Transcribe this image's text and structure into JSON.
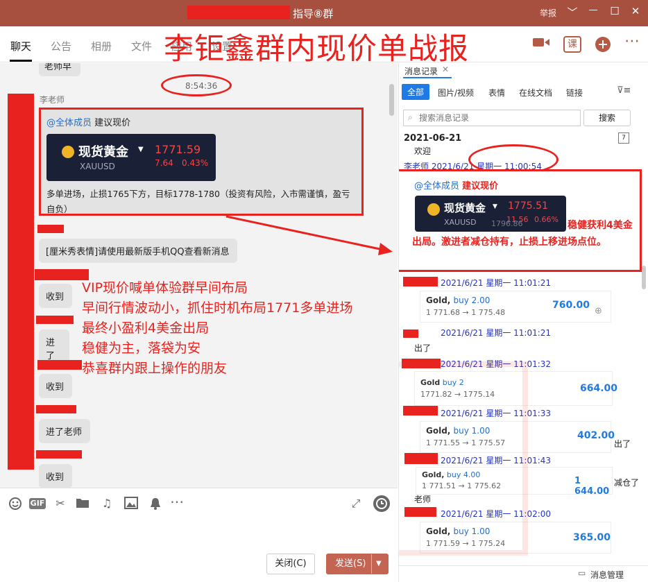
{
  "window": {
    "title": "指导⑧群",
    "report_label": "举报",
    "min_glyph": "—",
    "max_glyph": "☐",
    "close_glyph": "✕",
    "chevron_glyph": "﹀"
  },
  "tabs": [
    "聊天",
    "公告",
    "相册",
    "文件",
    "应用",
    "设置"
  ],
  "overlay_title": "李钜鑫群内现价单战报",
  "header_icons": {
    "video": "video-camera-icon",
    "course_label": "课",
    "add": "plus-circle-icon",
    "more": "⋯"
  },
  "chat": {
    "top_bubble": "老师早",
    "time": "8:54:36",
    "sender": "李老师",
    "post": {
      "at_all": "@全体成员",
      "headline": "建议现价",
      "card": {
        "name": "现货黄金",
        "symbol": "XAUUSD",
        "price": "1771.59",
        "change": "7.64",
        "change_pct": "0.43%"
      },
      "body": "多单进场，止损1765下方，目标1778-1780（投资有风险，入市需谨慎，盈亏自负）"
    },
    "sticker_msg": "[厘米秀表情]请使用最新版手机QQ查看新消息",
    "replies": [
      "收到",
      "进了",
      "收到",
      "进了老师",
      "收到"
    ],
    "announcement": [
      "VIP现价喊单体验群早间布局",
      "早间行情波动小，抓住时机布局1771多单进场",
      "最终小盈利4美金出局",
      "稳健为主，落袋为安",
      "恭喜群内跟上操作的朋友"
    ]
  },
  "toolbar": {
    "icons": [
      "emoji-icon",
      "gif-icon",
      "scissors-icon",
      "folder-icon",
      "music-icon",
      "image-icon",
      "bell-icon",
      "more-icon"
    ],
    "gif_label": "GIF",
    "close_btn": "关闭(C)",
    "send_btn": "发送(S)"
  },
  "history": {
    "panel_title": "消息记录",
    "filters": [
      "全部",
      "图片/视频",
      "表情",
      "在线文档",
      "链接"
    ],
    "search_placeholder": "搜索消息记录",
    "search_btn": "搜索",
    "date": "2021-06-21",
    "welcome": "欢迎",
    "first_ts": "李老师 2021/6/21 星期一 11:00:54",
    "highlight": {
      "at_all": "@全体成员",
      "headline": "建议现价",
      "card": {
        "name": "现货黄金",
        "symbol": "XAUUSD",
        "price": "1775.51",
        "change": "11.56",
        "change_pct": "0.66%",
        "sub": "1796.86"
      },
      "note": "稳健获利4美金出局。激进者减仓持有，止损上移进场点位。"
    },
    "entries": [
      {
        "ts": "2021/6/21 星期一 11:01:21",
        "gold": "Gold,",
        "buy": "buy 2.00",
        "path": "1 771.68 → 1 775.48",
        "profit": "760.00",
        "tail": "出了"
      },
      {
        "ts": "2021/6/21 星期一 11:01:32",
        "gold": "Gold",
        "buy": "buy 2",
        "path": "1771.82 → 1775.14",
        "profit": "664.00",
        "tail": ""
      },
      {
        "ts": "2021/6/21 星期一 11:01:33",
        "gold": "Gold,",
        "buy": "buy 1.00",
        "path": "1 771.55 → 1 775.57",
        "profit": "402.00",
        "tail": "出了"
      },
      {
        "ts": "2021/6/21 星期一 11:01:43",
        "gold": "Gold,",
        "buy": "buy 4.00",
        "path": "1 771.51 → 1 775.62",
        "profit": "1 644.00",
        "tail": "减仓了"
      },
      {
        "ts": "2021/6/21 星期一 11:02:00",
        "gold": "Gold,",
        "buy": "buy 1.00",
        "path": "1 771.59 → 1 775.24",
        "profit": "365.00",
        "tail": ""
      }
    ],
    "entry4_sender": "老师",
    "footer": "消息管理",
    "watermark": "鑫"
  }
}
